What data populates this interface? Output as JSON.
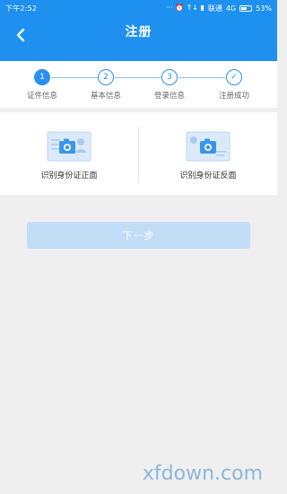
{
  "status_bar": {
    "time": "下午2:52",
    "icons": "··· ⏰ ↑↓ ▮",
    "carrier": "联通",
    "network": "4G",
    "battery": "53%"
  },
  "header": {
    "title": "注册"
  },
  "steps": [
    {
      "num": "1",
      "label": "证件信息",
      "state": "active"
    },
    {
      "num": "2",
      "label": "基本信息",
      "state": "pending"
    },
    {
      "num": "3",
      "label": "登录信息",
      "state": "pending"
    },
    {
      "num": "✓",
      "label": "注册成功",
      "state": "pending"
    }
  ],
  "id_cards": {
    "front_label": "识别身份证正面",
    "back_label": "识别身份证反面"
  },
  "next_button": {
    "label": "下一步"
  },
  "watermark": "xfdown.com",
  "colors": {
    "primary": "#1e90f0",
    "button_disabled": "#c2ddf6",
    "background": "#efefef"
  }
}
